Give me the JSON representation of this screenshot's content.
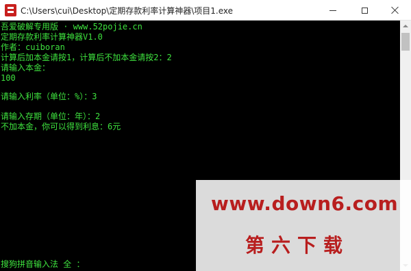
{
  "window": {
    "title": "C:\\Users\\cui\\Desktop\\定期存款利率计算神器\\项目1.exe"
  },
  "console": {
    "lines": [
      "吾爱破解专用版 · www.52pojie.cn",
      "定期存款利率计算神器V1.0",
      "作者：cuiboran",
      "计算后加本金请按1，计算后不加本金请按2：2",
      "请输入本金：",
      "100",
      "",
      "请输入利率（单位：%）：3",
      "",
      "请输入存期（单位：年）：2",
      "不加本金，你可以得到利息：6元"
    ],
    "ime_status": "搜狗拼音输入法 全 ："
  },
  "watermark": {
    "url": "www.down6.com",
    "name": "第六下载"
  },
  "colors": {
    "console_text": "#3ee23e",
    "console_bg": "#000000",
    "watermark": "#b81e1e"
  },
  "icons": {
    "app": "app-icon",
    "minimize": "minimize-icon",
    "maximize": "maximize-icon",
    "close": "close-icon"
  }
}
